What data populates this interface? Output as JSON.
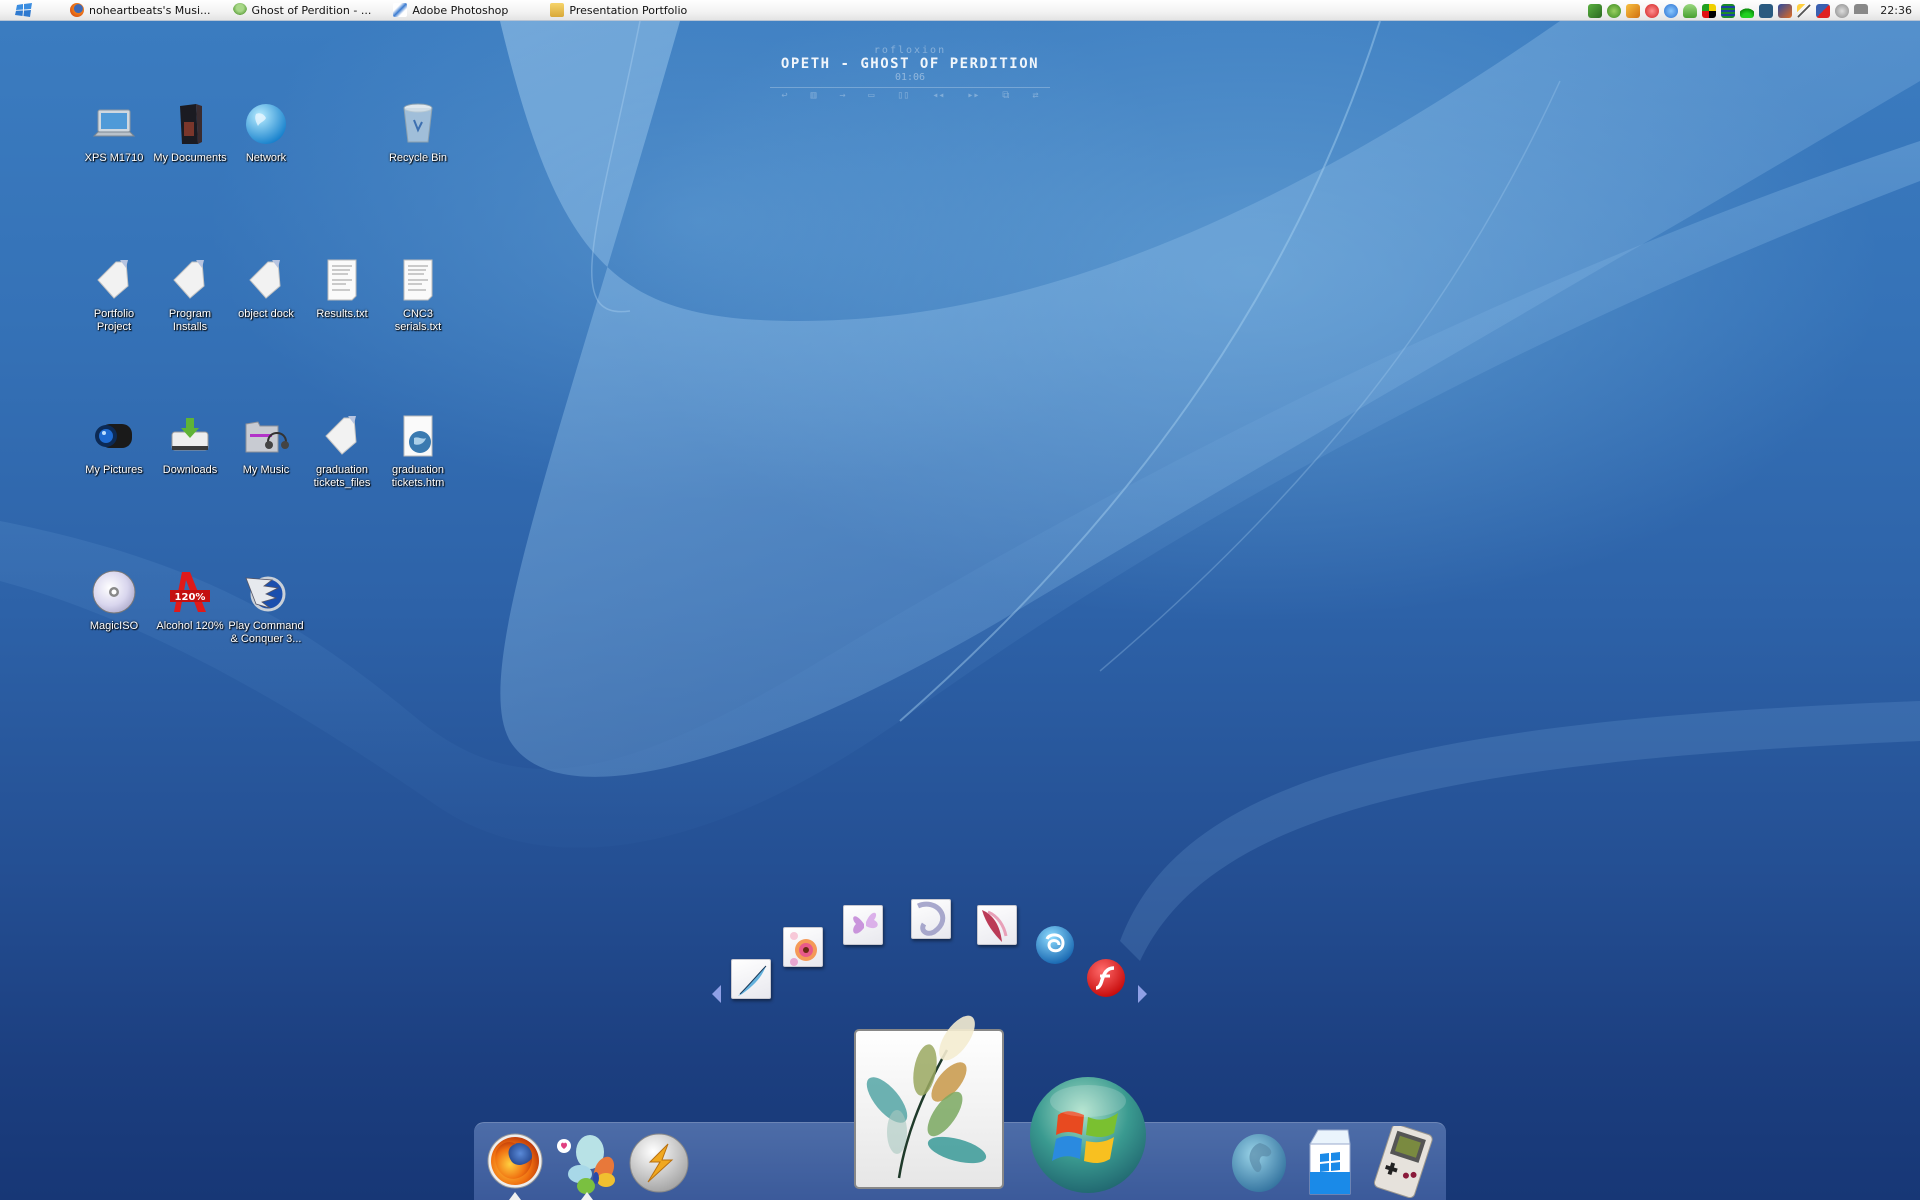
{
  "taskbar": {
    "start_icon": "windows-flag-icon",
    "tasks": [
      {
        "label": "noheartbeats's Musi...",
        "icon": "firefox-icon"
      },
      {
        "label": "Ghost of Perdition - ...",
        "icon": "winamp-person-icon"
      },
      {
        "label": "Adobe Photoshop",
        "icon": "photoshop-feather-icon"
      },
      {
        "label": "Presentation Portfolio",
        "icon": "folder-icon"
      }
    ],
    "tray_icons": [
      "network-device-icon",
      "utorrent-icon",
      "winamp-tray-icon",
      "red-stop-icon",
      "sync-icon",
      "messenger-icon",
      "color-blocks-icon",
      "list-grid-icon",
      "wireless-signal-icon",
      "channel-4-icon",
      "creative-suite-icon",
      "magic-wand-icon",
      "network-disconnected-icon",
      "volume-icon",
      "display-icon"
    ],
    "clock": "22:36"
  },
  "media_player": {
    "brand": "rofloxion",
    "track": "OPETH - GHOST OF PERDITION",
    "time": "01:06",
    "controls": [
      "repeat",
      "equalizer",
      "next-track",
      "stop",
      "pause",
      "rewind",
      "fast-forward",
      "playlist",
      "shuffle"
    ],
    "control_glyphs": [
      "↩",
      "▥",
      "→",
      "▭",
      "▯▯",
      "◂◂",
      "▸▸",
      "⧉",
      "⇄"
    ]
  },
  "desktop_icons": [
    {
      "label": "XPS M1710",
      "icon": "laptop-icon"
    },
    {
      "label": "My Documents",
      "icon": "documents-folder-icon"
    },
    {
      "label": "Network",
      "icon": "globe-icon"
    },
    {
      "label": "Recycle Bin",
      "icon": "recycle-bin-icon"
    },
    {
      "label": "Portfolio Project",
      "icon": "folder-icon"
    },
    {
      "label": "Program Installs",
      "icon": "folder-icon"
    },
    {
      "label": "object dock",
      "icon": "folder-icon"
    },
    {
      "label": "Results.txt",
      "icon": "text-file-icon"
    },
    {
      "label": "CNC3 serials.txt",
      "icon": "text-file-icon"
    },
    {
      "label": "My Pictures",
      "icon": "camera-lens-icon"
    },
    {
      "label": "Downloads",
      "icon": "download-drive-icon"
    },
    {
      "label": "My Music",
      "icon": "music-folder-icon"
    },
    {
      "label": "graduation tickets_files",
      "icon": "folder-icon"
    },
    {
      "label": "graduation tickets.htm",
      "icon": "html-file-icon"
    },
    {
      "label": "MagicISO",
      "icon": "disc-icon"
    },
    {
      "label": "Alcohol 120%",
      "icon": "alcohol-120-icon"
    },
    {
      "label": "Play Command & Conquer 3...",
      "icon": "cnc-eagle-icon"
    }
  ],
  "stack": {
    "items": [
      {
        "name": "adobe-photoshop",
        "icon": "photoshop-feather-icon"
      },
      {
        "name": "adobe-illustrator",
        "icon": "flower-icon"
      },
      {
        "name": "adobe-indesign",
        "icon": "butterfly-icon"
      },
      {
        "name": "adobe-dreamweaver",
        "icon": "swirl-icon"
      },
      {
        "name": "adobe-acrobat",
        "icon": "orchid-icon"
      },
      {
        "name": "3ds-max",
        "icon": "3dsmax-icon"
      },
      {
        "name": "flash",
        "icon": "flash-icon"
      }
    ],
    "prev_label": "previous",
    "next_label": "next"
  },
  "dock": {
    "items": [
      {
        "name": "firefox",
        "icon": "firefox-icon",
        "running": true
      },
      {
        "name": "windows-live-messenger",
        "icon": "messenger-butterfly-icon",
        "running": true
      },
      {
        "name": "winamp",
        "icon": "winamp-bolt-icon",
        "running": false
      },
      {
        "name": "adobe-creative-suite-stack",
        "icon": "leaf-stack-icon",
        "running": false
      },
      {
        "name": "start-menu",
        "icon": "windows-orb-icon",
        "running": false
      },
      {
        "name": "internet",
        "icon": "earth-icon",
        "running": false
      },
      {
        "name": "windows-milk",
        "icon": "milk-carton-icon",
        "running": false
      },
      {
        "name": "gameboy-emulator",
        "icon": "gameboy-icon",
        "running": false
      }
    ]
  },
  "colors": {
    "taskbar_bg": "#f4f4f4",
    "desktop_top": "#3b7cc0",
    "desktop_bottom": "#173776",
    "dock_shelf": "#6a8ccd"
  }
}
